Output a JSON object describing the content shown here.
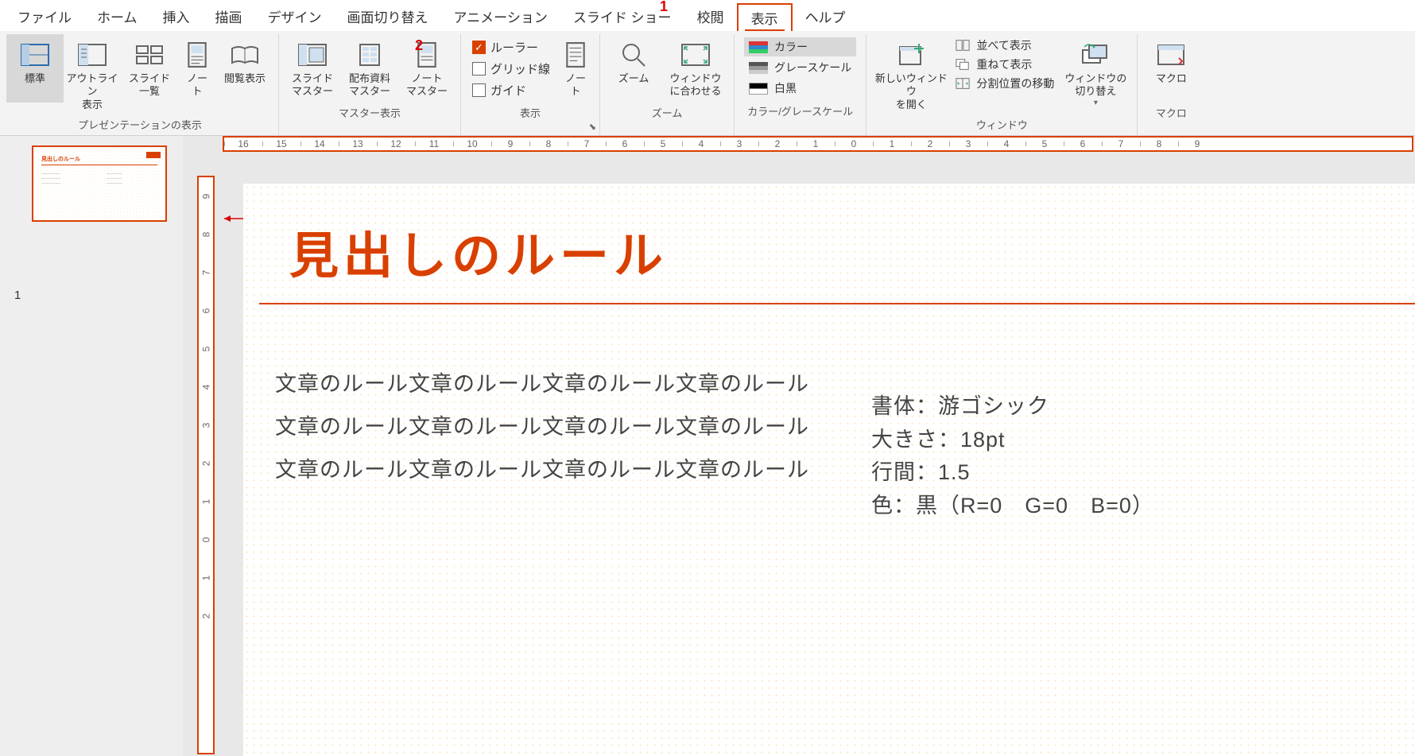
{
  "menu": {
    "items": [
      "ファイル",
      "ホーム",
      "挿入",
      "描画",
      "デザイン",
      "画面切り替え",
      "アニメーション",
      "スライド ショー",
      "校閲",
      "表示",
      "ヘルプ"
    ],
    "active": "表示"
  },
  "annotations": {
    "a1": "1",
    "a2": "2"
  },
  "ribbon": {
    "presentation": {
      "label": "プレゼンテーションの表示",
      "normal": "標準",
      "outline": "アウトライン\n表示",
      "sorter": "スライド\n一覧",
      "notes": "ノー\nト",
      "reading": "閲覧表示"
    },
    "master": {
      "label": "マスター表示",
      "slide": "スライド\nマスター",
      "handout": "配布資料\nマスター",
      "notes": "ノート\nマスター"
    },
    "show": {
      "label": "表示",
      "ruler": "ルーラー",
      "grid": "グリッド線",
      "guide": "ガイド",
      "notes": "ノー\nト"
    },
    "zoom": {
      "label": "ズーム",
      "zoom": "ズーム",
      "fit": "ウィンドウ\nに合わせる"
    },
    "color": {
      "label": "カラー/グレースケール",
      "color": "カラー",
      "gray": "グレースケール",
      "bw": "白黒"
    },
    "window": {
      "label": "ウィンドウ",
      "new": "新しいウィンドウ\nを開く",
      "arrange": "並べて表示",
      "cascade": "重ねて表示",
      "split": "分割位置の移動",
      "switch": "ウィンドウの\n切り替え"
    },
    "macro": {
      "label": "マクロ",
      "macro": "マクロ"
    }
  },
  "ruler_h": [
    "16",
    "15",
    "14",
    "13",
    "12",
    "11",
    "10",
    "9",
    "8",
    "7",
    "6",
    "5",
    "4",
    "3",
    "2",
    "1",
    "0",
    "1",
    "2",
    "3",
    "4",
    "5",
    "6",
    "7",
    "8",
    "9"
  ],
  "ruler_v": [
    "9",
    "8",
    "7",
    "6",
    "5",
    "4",
    "3",
    "2",
    "1",
    "0",
    "1",
    "2"
  ],
  "thumbnail": {
    "num": "1",
    "title": "見出しのルール"
  },
  "slide": {
    "title": "見出しのルール",
    "body": "文章のルール文章のルール文章のルール文章のルール文章のルール文章のルール文章のルール文章のルール文章のルール文章のルール文章のルール文章のルール",
    "info": {
      "font": "書体：游ゴシック",
      "size": "大きさ：18pt",
      "line": "行間：1.5",
      "color": "色：黒（R=0　G=0　B=0）"
    }
  }
}
